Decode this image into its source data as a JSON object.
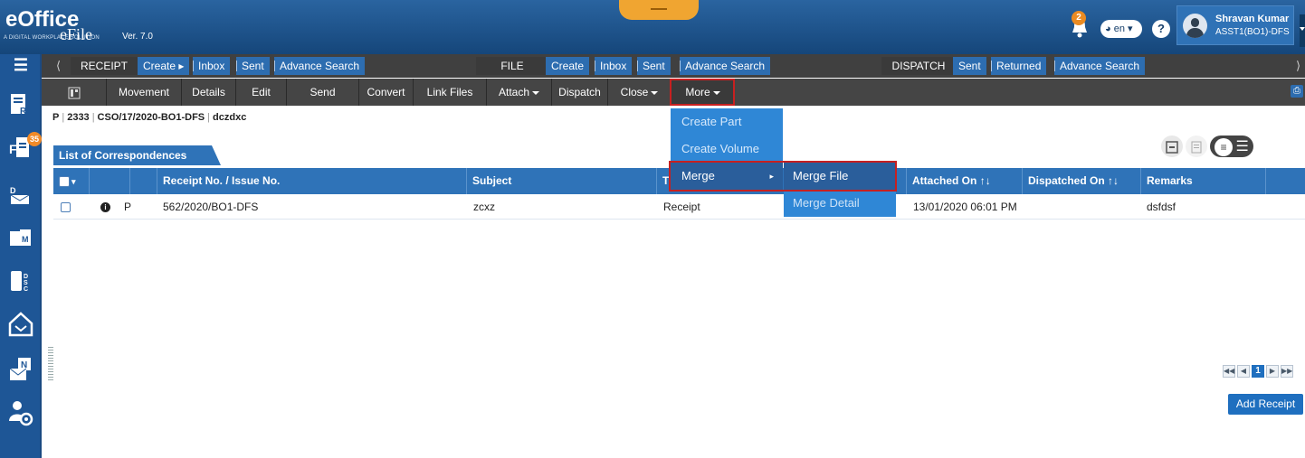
{
  "header": {
    "logo_text": "eOffice",
    "logo_subtitle": "A DIGITAL WORKPLACE SOLUTION",
    "app_name": "eFile",
    "version": "Ver. 7.0",
    "notification_count": "2",
    "language": "en",
    "help": "?",
    "user_name": "Shravan Kumar",
    "user_role": "ASST1(BO1)-DFS"
  },
  "nav": {
    "receipt": {
      "label": "RECEIPT",
      "create": "Create",
      "inbox": "Inbox",
      "sent": "Sent",
      "advance_search": "Advance Search"
    },
    "file": {
      "label": "FILE",
      "create": "Create",
      "inbox": "Inbox",
      "sent": "Sent",
      "advance_search": "Advance Search"
    },
    "dispatch": {
      "label": "DISPATCH",
      "sent": "Sent",
      "returned": "Returned",
      "advance_search": "Advance Search"
    }
  },
  "toolbar": {
    "movement": "Movement",
    "details": "Details",
    "edit": "Edit",
    "send": "Send",
    "convert": "Convert",
    "link_files": "Link Files",
    "attach": "Attach",
    "dispatch": "Dispatch",
    "close": "Close",
    "more": "More"
  },
  "breadcrumb": {
    "type": "P",
    "number": "2333",
    "file_no": "CSO/17/2020-BO1-DFS",
    "subject": "dczdxc"
  },
  "sidebar": {
    "inbox_badge": "35"
  },
  "section_title": "List of Correspondences",
  "table": {
    "headers": {
      "receipt_no": "Receipt No. / Issue No.",
      "subject": "Subject",
      "type": "T",
      "attached_on": "Attached On",
      "dispatched_on": "Dispatched On",
      "remarks": "Remarks"
    },
    "rows": [
      {
        "flag": "P",
        "receipt_no": "562/2020/BO1-DFS",
        "subject": "zcxz",
        "type": "Receipt",
        "attached_on": "13/01/2020 06:01 PM",
        "dispatched_on": "",
        "remarks": "dsfdsf"
      }
    ]
  },
  "more_menu": {
    "items": [
      "Create Part",
      "Create Volume",
      "Merge"
    ],
    "submenu": [
      "Merge File",
      "Merge Detail"
    ]
  },
  "pagination": {
    "current_page": "1"
  },
  "actions": {
    "add_receipt": "Add Receipt"
  },
  "colors": {
    "header_blue": "#1d4f86",
    "accent_blue": "#2f73b8",
    "nav_dark": "#404040",
    "highlight_red": "#c72020",
    "menu_blue": "#2f87d6"
  }
}
